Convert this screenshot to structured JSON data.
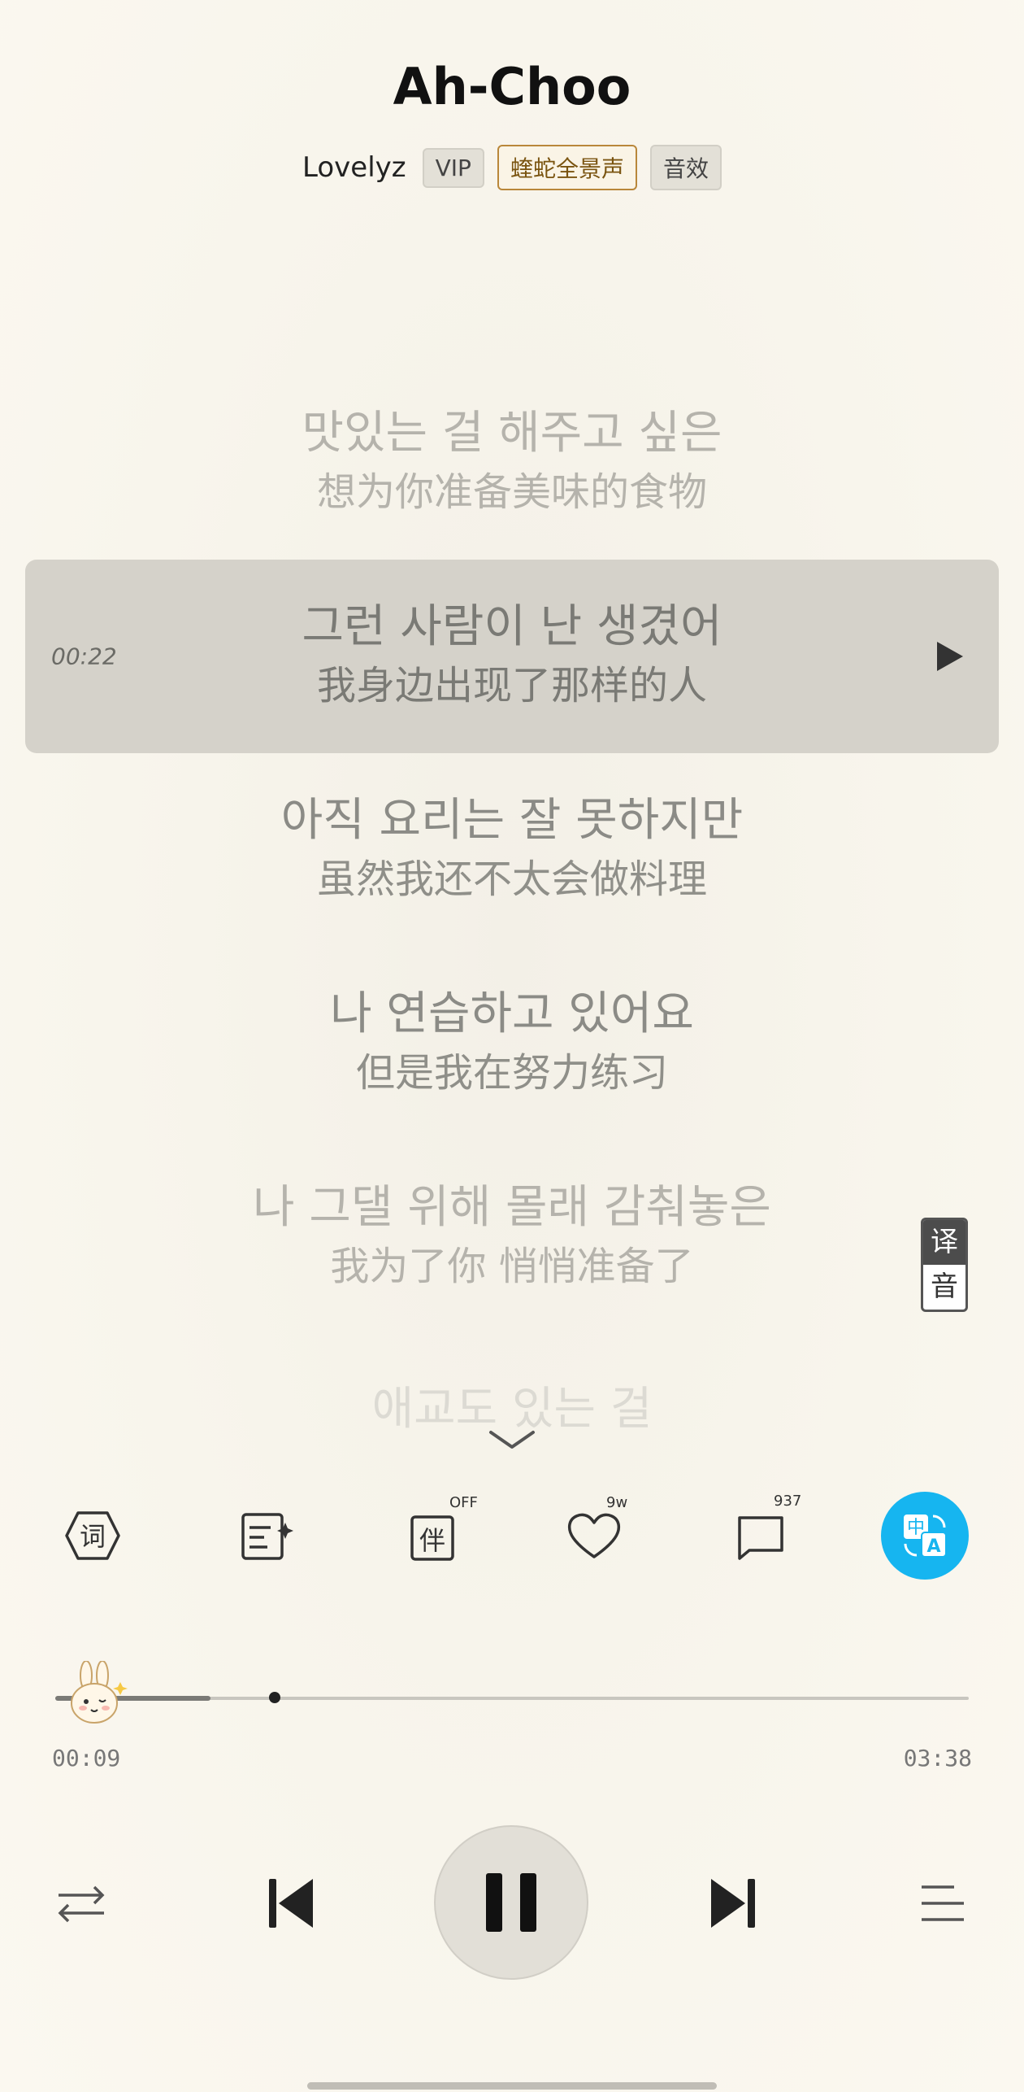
{
  "song": {
    "title": "Ah-Choo",
    "artist": "Lovelyz",
    "tags": [
      "VIP",
      "蝰蛇全景声",
      "音效"
    ]
  },
  "lyrics": [
    {
      "ko": "맛있는 걸 해주고 싶은",
      "zh": "想为你准备美味的食物"
    },
    {
      "ko": "그런 사람이 난 생겼어",
      "zh": "我身边出现了那样的人",
      "time": "00:22",
      "active": true
    },
    {
      "ko": "아직 요리는 잘 못하지만",
      "zh": "虽然我还不太会做料理"
    },
    {
      "ko": "나 연습하고 있어요",
      "zh": "但是我在努力练习"
    },
    {
      "ko": "나 그댈 위해 몰래 감춰놓은",
      "zh": "我为了你 悄悄准备了"
    },
    {
      "ko": "애교도 있는 걸",
      "zh": ""
    }
  ],
  "translation_toggle": {
    "translate": "译",
    "phonetic": "音"
  },
  "actions": {
    "lyrics_label": "词",
    "accompany_badge": "OFF",
    "like_count": "9w",
    "comment_count": "937"
  },
  "progress": {
    "current": "00:09",
    "total": "03:38",
    "played_fraction": 0.04,
    "buffered_fraction": 0.17,
    "marker_fraction": 0.24
  },
  "colors": {
    "accent": "#16b5f0",
    "background": "#f8f5ec",
    "active_lyric_bg": "#d5d2ca"
  },
  "icons": [
    "lyrics-hexagon-icon",
    "lyric-poster-icon",
    "accompany-icon",
    "heart-icon",
    "comment-icon",
    "translate-icon",
    "shuffle-icon",
    "previous-icon",
    "pause-icon",
    "next-icon",
    "playlist-icon",
    "chevron-down-icon",
    "play-icon"
  ]
}
